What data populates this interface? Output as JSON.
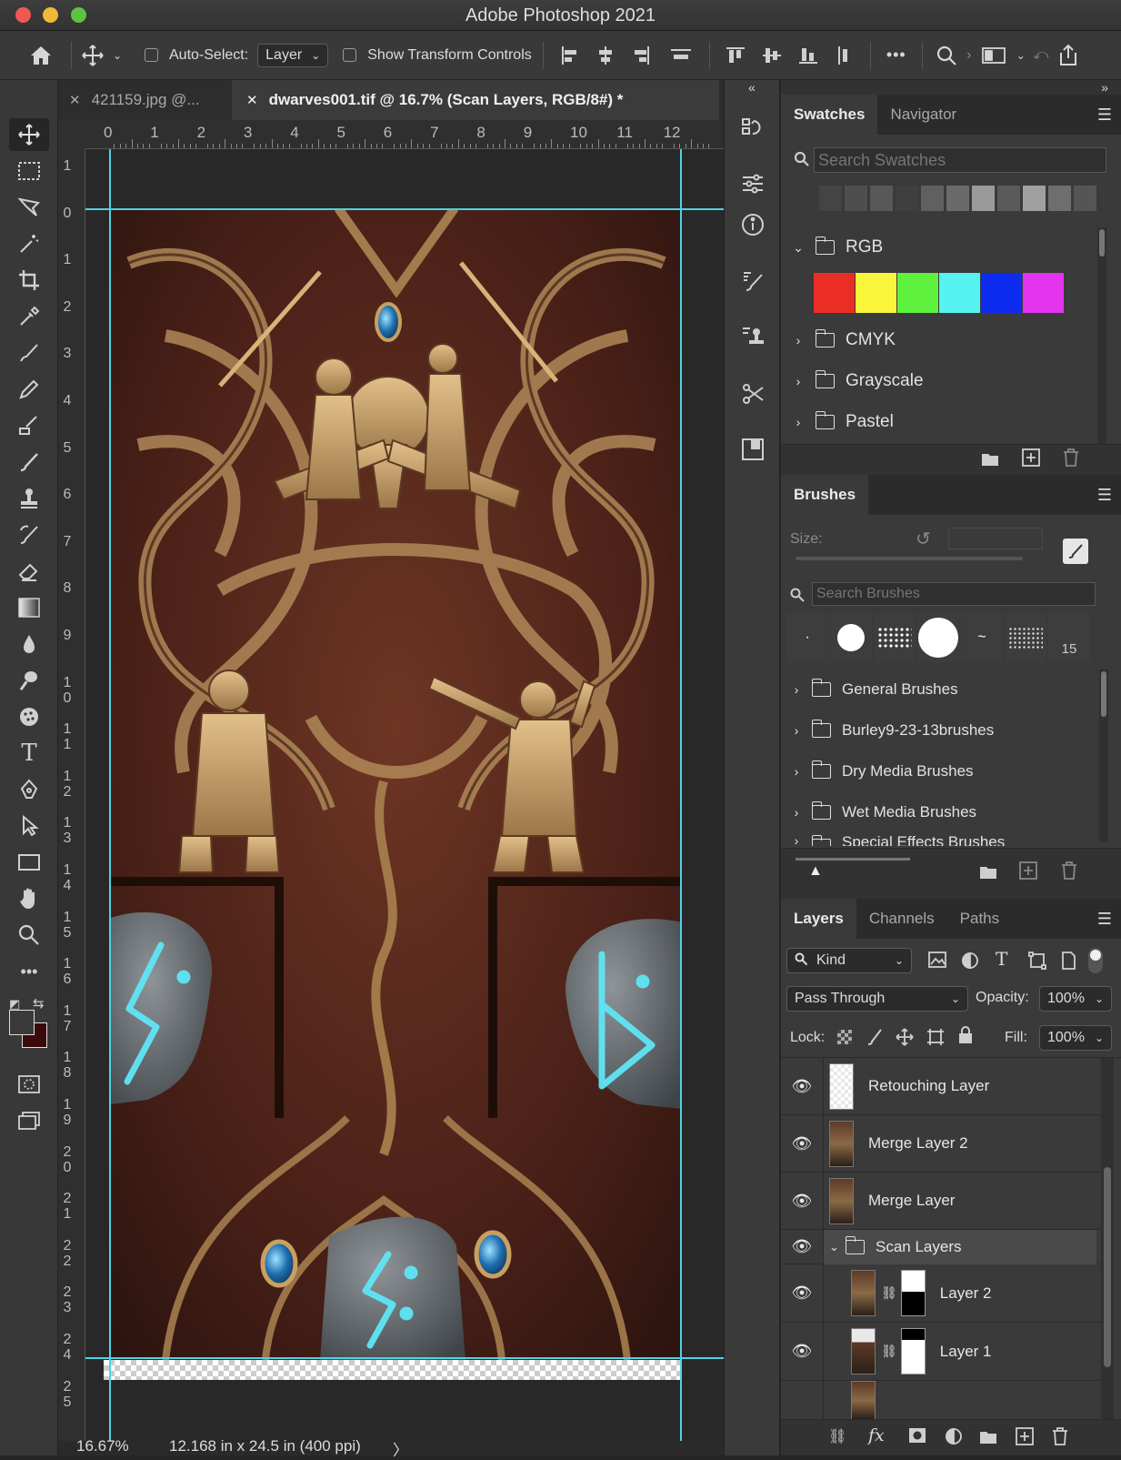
{
  "app": {
    "title": "Adobe Photoshop 2021"
  },
  "options_bar": {
    "auto_select_label": "Auto-Select:",
    "auto_select_value": "Layer",
    "show_transform_label": "Show Transform Controls",
    "more_label": "•••"
  },
  "document_tabs": [
    {
      "label": "421159.jpg @...",
      "active": false
    },
    {
      "label": "dwarves001.tif @ 16.7% (Scan Layers, RGB/8#) *",
      "active": true
    }
  ],
  "rulers": {
    "horizontal": [
      "0",
      "1",
      "2",
      "3",
      "4",
      "5",
      "6",
      "7",
      "8",
      "9",
      "10",
      "11",
      "12"
    ],
    "vertical": [
      "1",
      "0",
      "1",
      "2",
      "3",
      "4",
      "5",
      "6",
      "7",
      "8",
      "9",
      "1\n0",
      "1\n1",
      "1\n2",
      "1\n3",
      "1\n4",
      "1\n5",
      "1\n6",
      "1\n7",
      "1\n8",
      "1\n9",
      "2\n0",
      "2\n1",
      "2\n2",
      "2\n3",
      "2\n4",
      "2\n5"
    ]
  },
  "status_bar": {
    "zoom": "16.67%",
    "doc_info": "12.168 in x 24.5 in (400 ppi)",
    "arrow": "〉"
  },
  "swatches_panel": {
    "tabs": [
      "Swatches",
      "Navigator"
    ],
    "search_placeholder": "Search Swatches",
    "recent_swatches": [
      "#3a3a3a",
      "#444444",
      "#4e4e4e",
      "#585858",
      "#3f3f3f",
      "#606060",
      "#6a6a6a",
      "#9a9a9a",
      "#5a5a5a",
      "#a0a0a0",
      "#6e6e6e",
      "#555555"
    ],
    "groups": [
      {
        "name": "RGB",
        "expanded": true,
        "colors": [
          "#ea2e25",
          "#f8f53a",
          "#5ef13d",
          "#55f2f1",
          "#0d2cf0",
          "#e434ee"
        ]
      },
      {
        "name": "CMYK",
        "expanded": false
      },
      {
        "name": "Grayscale",
        "expanded": false
      },
      {
        "name": "Pastel",
        "expanded": false
      }
    ]
  },
  "brushes_panel": {
    "title": "Brushes",
    "size_label": "Size:",
    "search_placeholder": "Search Brushes",
    "preset_count_label": "15",
    "groups": [
      "General Brushes",
      "Burley9-23-13brushes",
      "Dry Media Brushes",
      "Wet Media Brushes",
      "Special Effects Brushes"
    ]
  },
  "layers_panel": {
    "tabs": [
      "Layers",
      "Channels",
      "Paths"
    ],
    "kind_label": "Kind",
    "blend_mode": "Pass Through",
    "opacity_label": "Opacity:",
    "opacity_value": "100%",
    "lock_label": "Lock:",
    "fill_label": "Fill:",
    "fill_value": "100%",
    "layers": [
      {
        "name": "Retouching Layer",
        "visible": true,
        "type": "pixel"
      },
      {
        "name": "Merge Layer 2",
        "visible": true,
        "type": "pixel"
      },
      {
        "name": "Merge Layer",
        "visible": true,
        "type": "pixel"
      },
      {
        "name": "Scan Layers",
        "visible": true,
        "type": "group",
        "expanded": true,
        "selected": true
      },
      {
        "name": "Layer 2",
        "visible": true,
        "type": "masked",
        "indent": true
      },
      {
        "name": "Layer 1",
        "visible": true,
        "type": "masked",
        "indent": true
      }
    ],
    "footer_fx": "fx"
  },
  "colors": {
    "accent_guide": "#4dd3e3",
    "foreground": "#3a3a3a",
    "background": "#3b0a0a"
  }
}
